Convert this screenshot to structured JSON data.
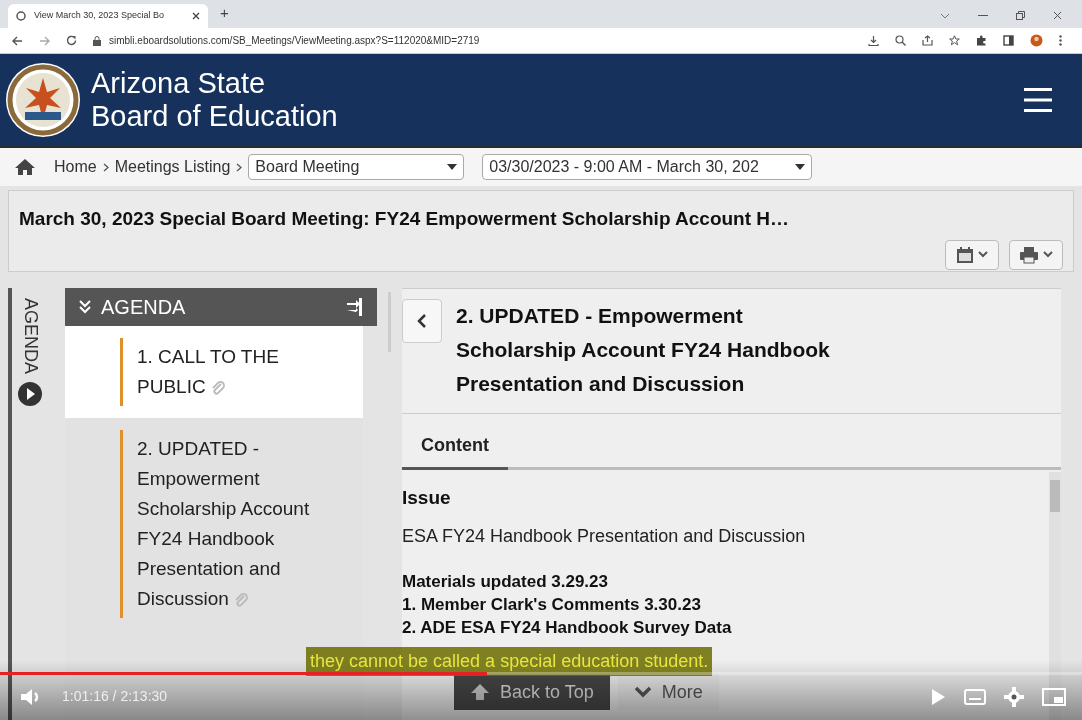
{
  "browser": {
    "tab_title": "View March 30, 2023 Special Bo",
    "new_tab": "+",
    "url": "simbli.eboardsolutions.com/SB_Meetings/ViewMeeting.aspx?S=112020&MID=2719"
  },
  "header": {
    "title_lines": [
      "Arizona State",
      "Board of Education"
    ]
  },
  "breadcrumb": {
    "items": [
      "Home",
      "Meetings Listing"
    ],
    "meeting_type": "Board Meeting",
    "meeting_date": "03/30/2023 - 9:00 AM - March 30, 202"
  },
  "meeting_title": "March 30, 2023 Special Board Meeting: FY24 Empowerment Scholarship Account H…",
  "agenda": {
    "side_tab": "AGENDA",
    "heading": "AGENDA",
    "items": [
      {
        "title": "1. CALL TO THE PUBLIC",
        "selected": false,
        "attachment": true
      },
      {
        "title": "2. UPDATED - Empowerment Scholarship Account FY24 Handbook Presentation and Discussion",
        "selected": true,
        "attachment": true
      }
    ]
  },
  "item_detail": {
    "title": "2. UPDATED - Empowerment Scholarship Account FY24 Handbook Presentation and Discussion",
    "tabs": [
      {
        "label": "Content",
        "selected": true
      }
    ],
    "sections": [
      {
        "kind": "heading",
        "text": "Issue"
      },
      {
        "kind": "text",
        "text": "ESA FY24 Handbook Presentation and Discussion"
      },
      {
        "kind": "bold",
        "text": "Materials updated 3.29.23"
      },
      {
        "kind": "bold",
        "text": "1. Member Clark's Comments 3.30.23"
      },
      {
        "kind": "bold",
        "text": "2. ADE ESA FY24 Handbook Survey Data"
      }
    ]
  },
  "page_buttons": [
    {
      "kind": "up",
      "label": "Back to Top"
    },
    {
      "kind": "down",
      "label": "More"
    }
  ],
  "video": {
    "caption": "they cannot be called a special education student.",
    "time": "1:01:16 / 2:13:30",
    "progress": {
      "level": 0.45
    }
  }
}
